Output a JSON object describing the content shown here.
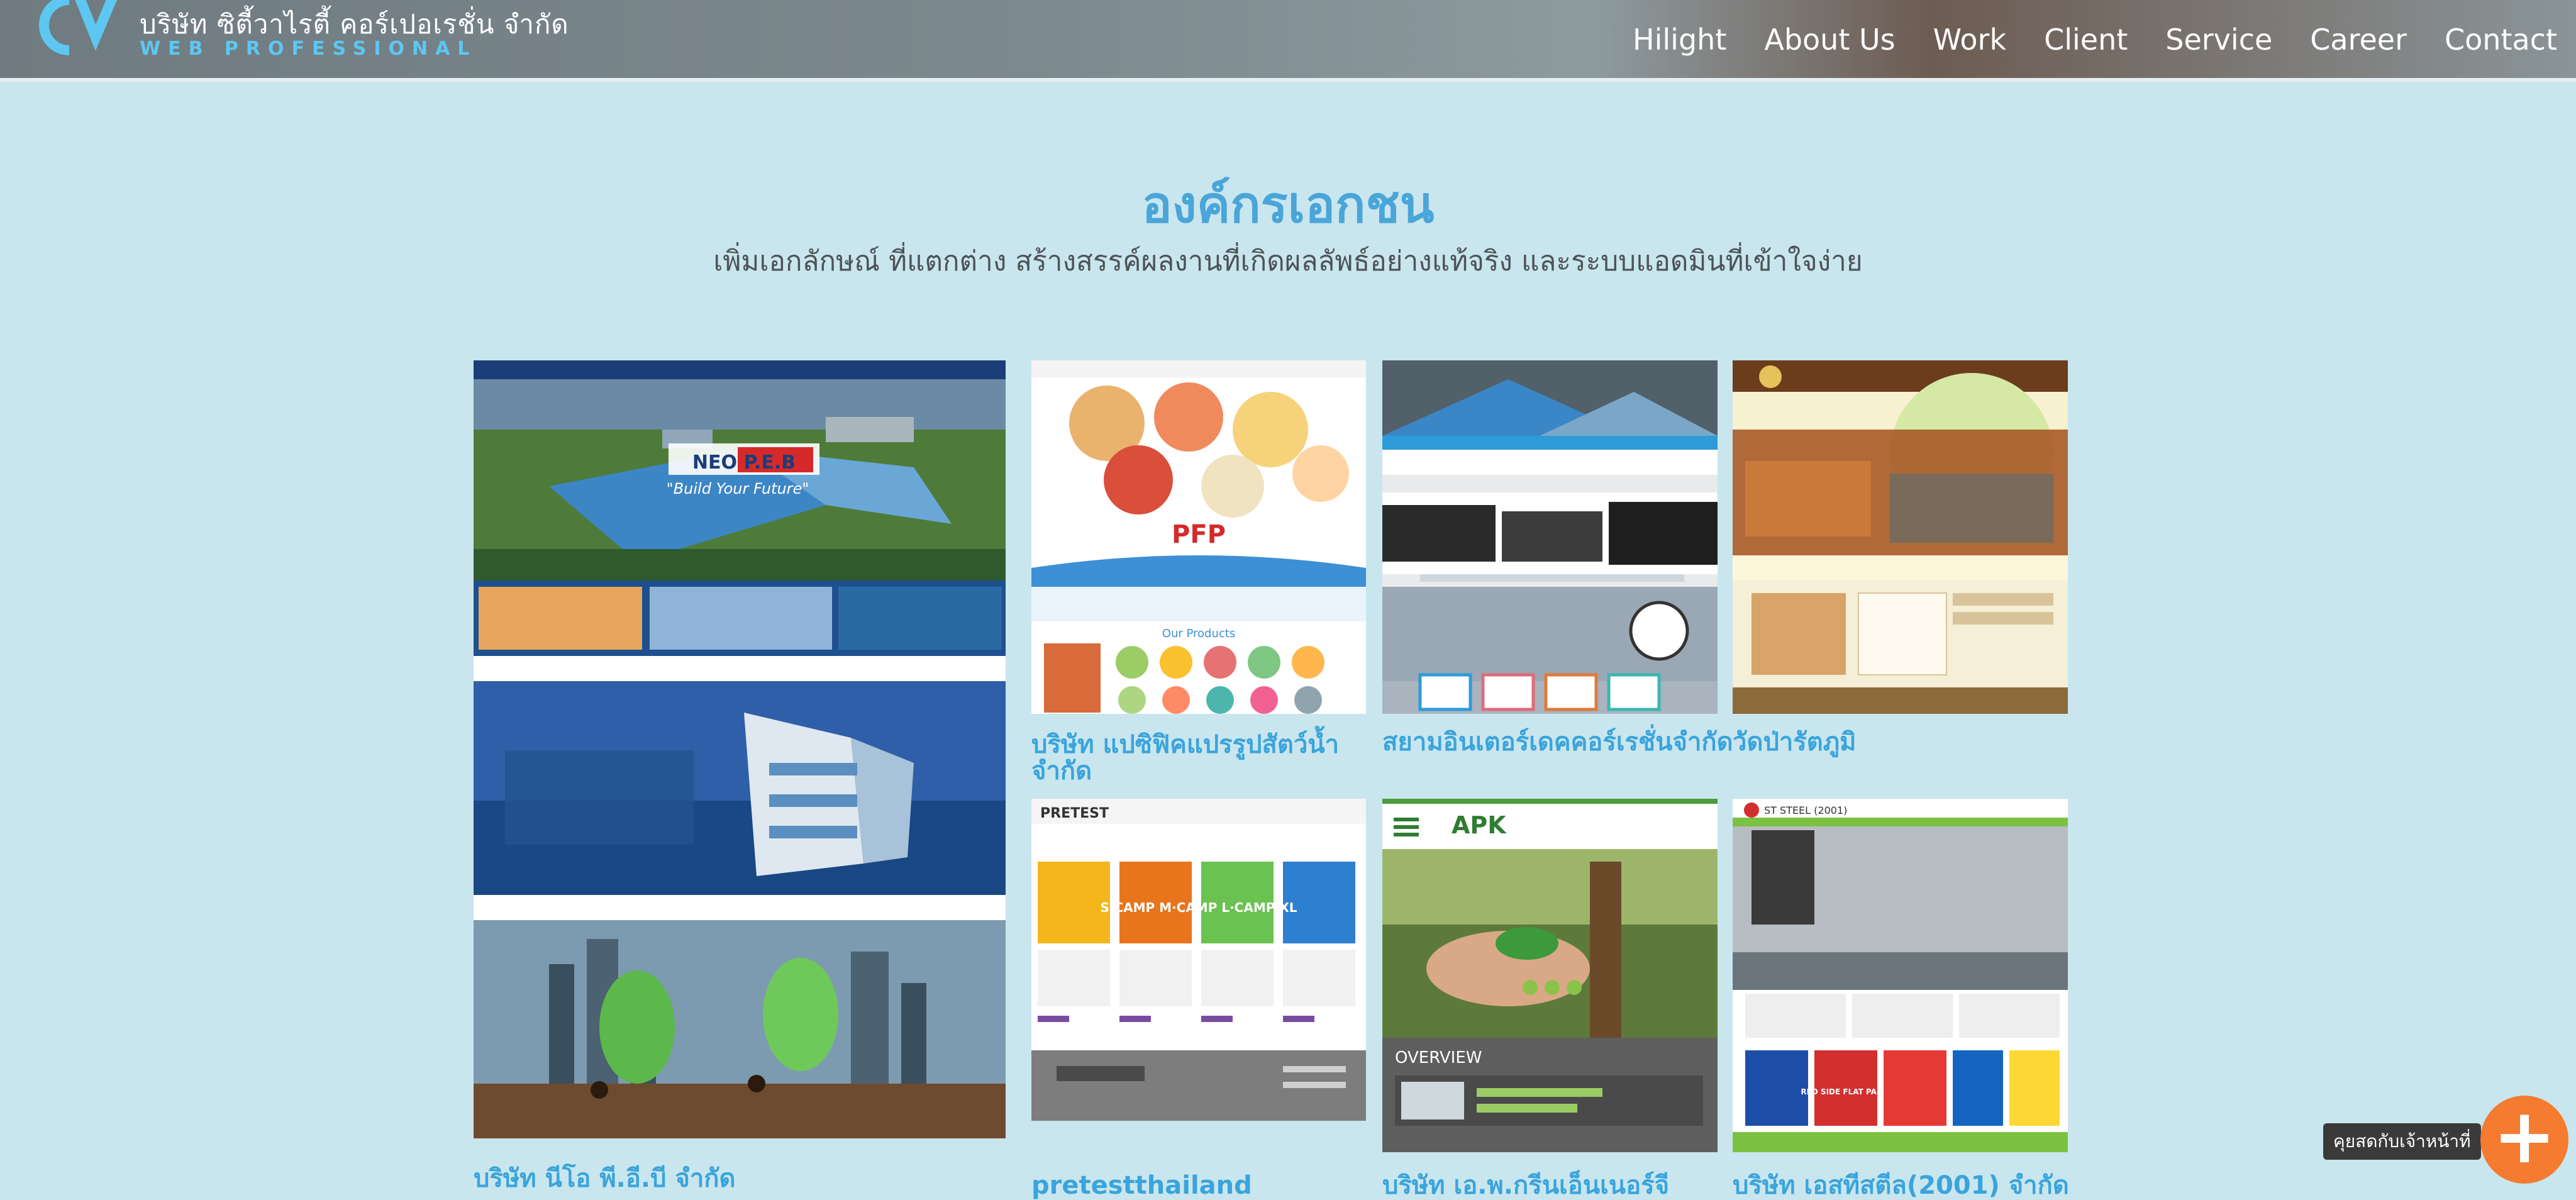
{
  "header": {
    "company_name": "บริษัท ซิตี้วาไรตี้ คอร์เปอเรชั่น จำกัด",
    "tagline": "WEB PROFESSIONAL",
    "nav": [
      "Hilight",
      "About Us",
      "Work",
      "Client",
      "Service",
      "Career",
      "Contact"
    ]
  },
  "section": {
    "title": "องค์กรเอกชน",
    "subtitle": "เพิ่มเอกลักษณ์ ที่แตกต่าง สร้างสรรค์ผลงานที่เกิดผลลัพธ์อย่างแท้จริง และระบบแอดมินที่เข้าใจง่าย"
  },
  "portfolio": [
    {
      "title": "บริษัท นีโอ พี.อี.บี จำกัด",
      "thumb_text": "NEO P.E.B",
      "thumb_sub": "\"Build Your Future\""
    },
    {
      "title": "บริษัท แปซิฟิคแปรรูปสัตว์น้ำ จำกัด",
      "thumb_text": "PFP",
      "thumb_sub": "Our Products"
    },
    {
      "title": "สยามอินเตอร์เดคคอร์เรชั่นจำกัด",
      "thumb_text": "",
      "thumb_sub": ""
    },
    {
      "title": "วัดป่ารัตภูมิ",
      "thumb_text": "",
      "thumb_sub": ""
    },
    {
      "title": "pretestthailand",
      "thumb_text": "PRETEST",
      "thumb_sub": "S·CAMP M·CAMP L·CAMP XL"
    },
    {
      "title": "บริษัท เอ.พ.กรีนเอ็นเนอร์จี",
      "thumb_text": "APK",
      "thumb_sub": "OVERVIEW"
    },
    {
      "title": "บริษัท เอสทีสตีล(2001) จำกัด",
      "thumb_text": "ST STEEL (2001)",
      "thumb_sub": "RED SIDE FLAT PAINT"
    }
  ],
  "chat": {
    "label": "คุยสดกับเจ้าหน้าที่",
    "icon": "plus-icon"
  },
  "colors": {
    "accent": "#4aa5d8",
    "background": "#c9e6ee",
    "fab": "#f47b30"
  }
}
